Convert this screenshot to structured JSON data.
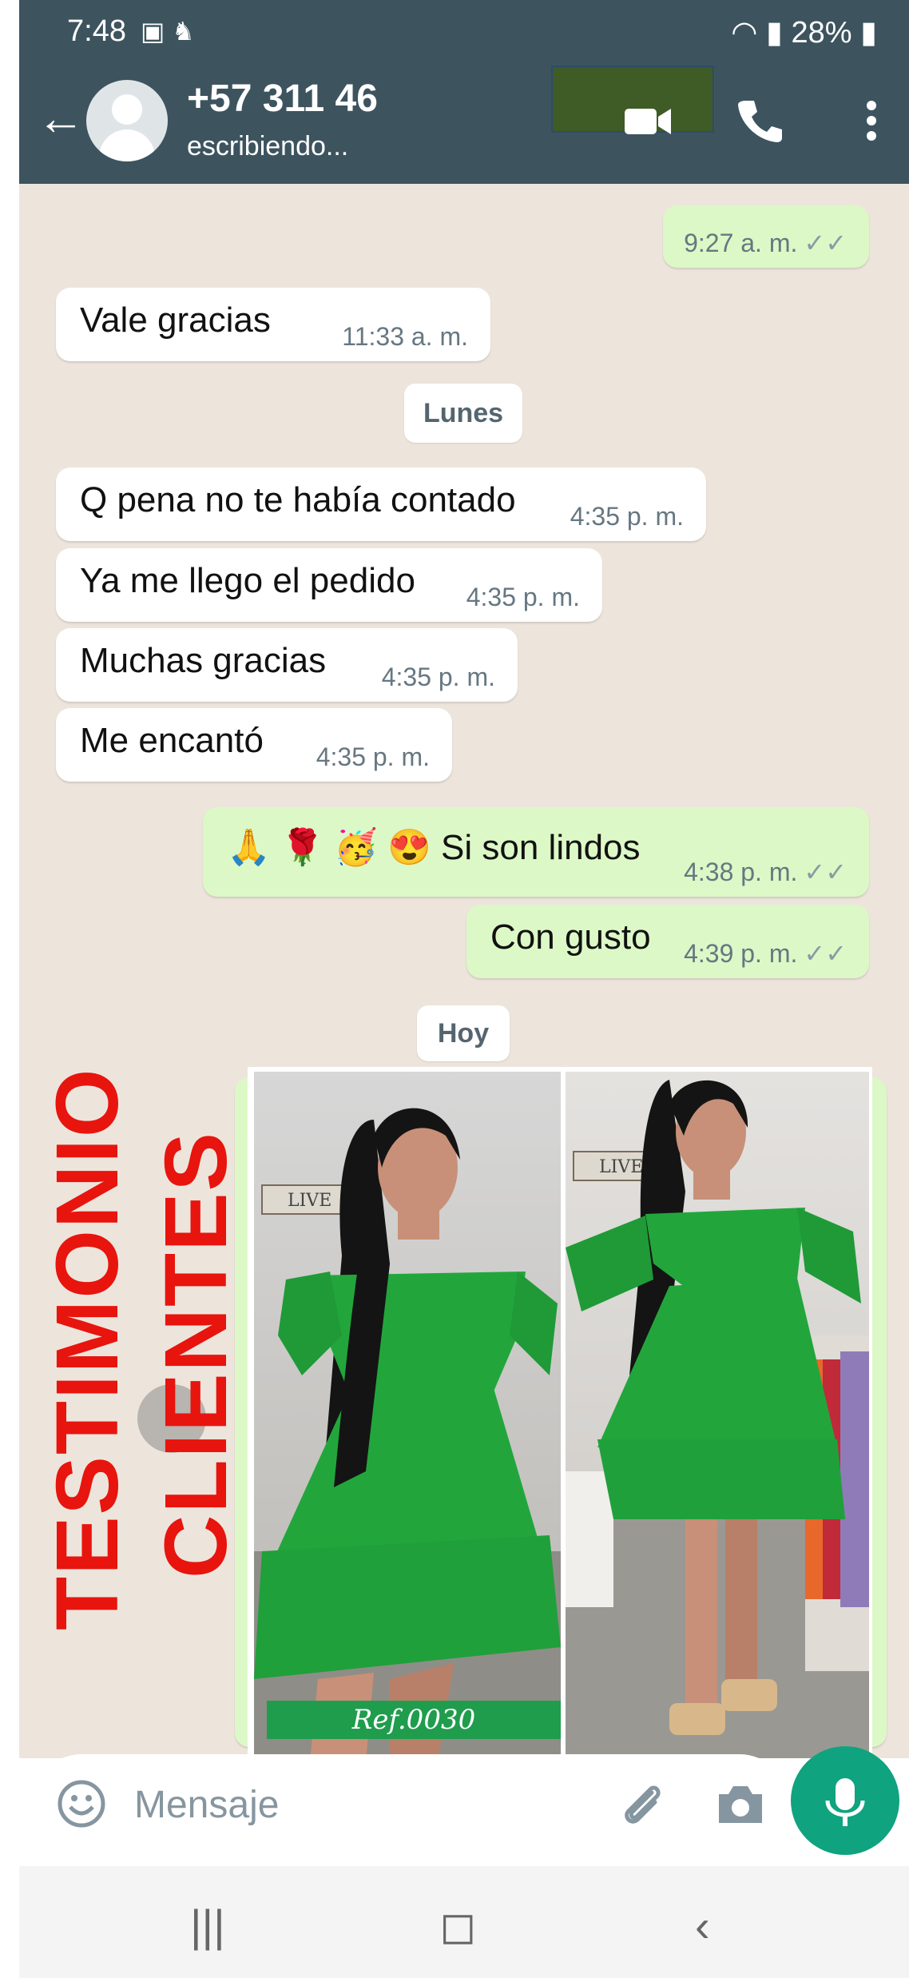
{
  "status_bar": {
    "time": "7:48",
    "battery": "28%"
  },
  "header": {
    "contact_name": "+57 311 46",
    "subtitle": "escribiendo..."
  },
  "messages": [
    {
      "text": "",
      "time": "9:27 a. m.",
      "ticks": "✓✓"
    },
    {
      "text": "Vale gracias",
      "time": "11:33 a. m."
    },
    {
      "text": "Q pena no te había contado",
      "time": "4:35 p. m."
    },
    {
      "text": "Ya me llego el pedido",
      "time": "4:35 p. m."
    },
    {
      "text": "Muchas gracias",
      "time": "4:35 p. m."
    },
    {
      "text": "Me encantó",
      "time": "4:35 p. m."
    },
    {
      "text": "🙏 🌹 🥳 😍 Si son lindos",
      "time": "4:38 p. m.",
      "ticks": "✓✓"
    },
    {
      "text": "Con gusto",
      "time": "4:39 p. m.",
      "ticks": "✓✓"
    }
  ],
  "dates": {
    "lunes": "Lunes",
    "hoy": "Hoy"
  },
  "overlay": {
    "line1": "TESTIMONIO",
    "line2": "CLIENTES"
  },
  "product": {
    "ref": "Ref.0030",
    "sign": "LIVE",
    "dress_color": "#22a63c"
  },
  "composer": {
    "placeholder": "Mensaje"
  },
  "colors": {
    "header": "#3d545f",
    "outgoing": "#dcf8c6",
    "chat_bg": "#ede5dc",
    "mic": "#0fa37f",
    "overlay_text": "#e8140e"
  },
  "icons": [
    "back-arrow-icon",
    "video-call-icon",
    "phone-icon",
    "menu-dots-icon",
    "emoji-icon",
    "attach-icon",
    "camera-icon",
    "mic-icon"
  ]
}
